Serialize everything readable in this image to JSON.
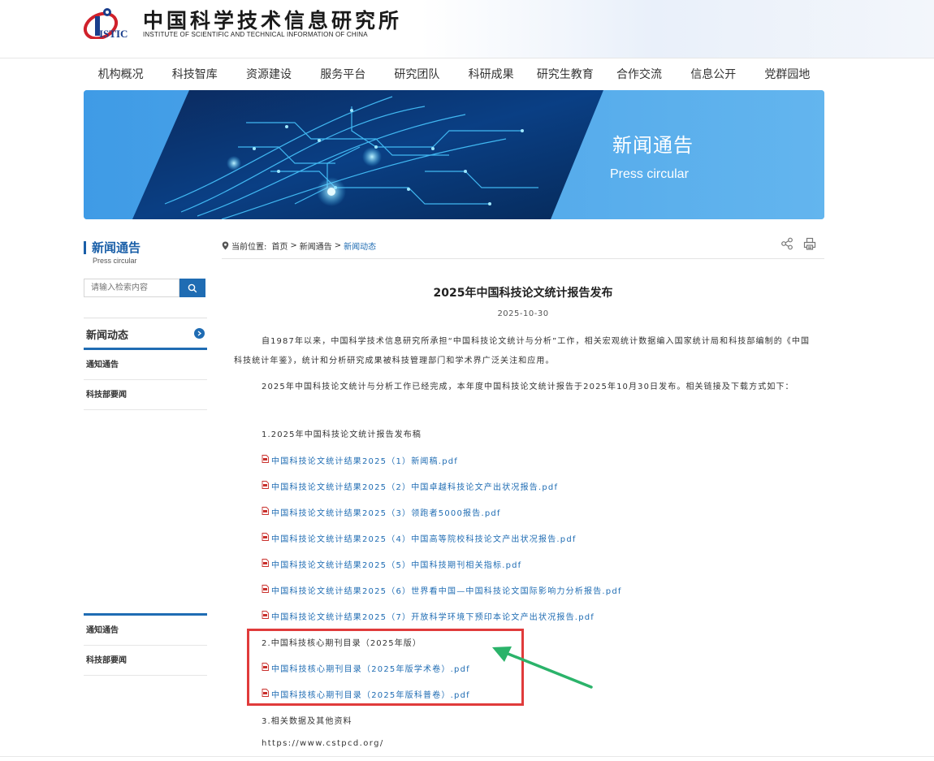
{
  "header": {
    "logo_text": "ISTIC",
    "title_cn": "中国科学技术信息研究所",
    "title_en": "INSTITUTE OF SCIENTIFIC AND TECHNICAL INFORMATION OF CHINA"
  },
  "nav": {
    "items": [
      "机构概况",
      "科技智库",
      "资源建设",
      "服务平台",
      "研究团队",
      "科研成果",
      "研究生教育",
      "合作交流",
      "信息公开",
      "党群园地"
    ]
  },
  "banner": {
    "title": "新闻通告",
    "subtitle": "Press circular"
  },
  "sidebar": {
    "title": "新闻通告",
    "subtitle": "Press circular",
    "search_placeholder": "请输入检索内容",
    "category": "新闻动态",
    "links_top": [
      "通知通告",
      "科技部要闻"
    ],
    "links_bottom": [
      "通知通告",
      "科技部要闻"
    ]
  },
  "breadcrumb": {
    "prefix": "当前位置:",
    "home": "首页",
    "sep": ">",
    "section": "新闻通告",
    "current": "新闻动态"
  },
  "article": {
    "title": "2025年中国科技论文统计报告发布",
    "date": "2025-10-30",
    "para1": "自1987年以来，中国科学技术信息研究所承担“中国科技论文统计与分析”工作，相关宏观统计数据编入国家统计局和科技部编制的《中国科技统计年鉴》，统计和分析研究成果被科技管理部门和学术界广泛关注和应用。",
    "para2": "2025年中国科技论文统计与分析工作已经完成，本年度中国科技论文统计报告于2025年10月30日发布。相关链接及下载方式如下：",
    "section1": "1.2025年中国科技论文统计报告发布稿",
    "files1": [
      "中国科技论文统计结果2025（1）新闻稿.pdf",
      "中国科技论文统计结果2025（2）中国卓越科技论文产出状况报告.pdf",
      "中国科技论文统计结果2025（3）领跑者5000报告.pdf",
      "中国科技论文统计结果2025（4）中国高等院校科技论文产出状况报告.pdf",
      "中国科技论文统计结果2025（5）中国科技期刊相关指标.pdf",
      "中国科技论文统计结果2025（6）世界看中国—中国科技论文国际影响力分析报告.pdf",
      "中国科技论文统计结果2025（7）开放科学环境下预印本论文产出状况报告.pdf"
    ],
    "section2": "2.中国科技核心期刊目录（2025年版）",
    "files2": [
      "中国科技核心期刊目录（2025年版学术卷）.pdf",
      "中国科技核心期刊目录（2025年版科普卷）.pdf"
    ],
    "section3": "3.相关数据及其他资料",
    "url": "https://www.cstpcd.org/"
  },
  "colors": {
    "brand_blue": "#1f6cb3",
    "highlight_red": "#e03b3b",
    "arrow_green": "#2bb36a"
  }
}
